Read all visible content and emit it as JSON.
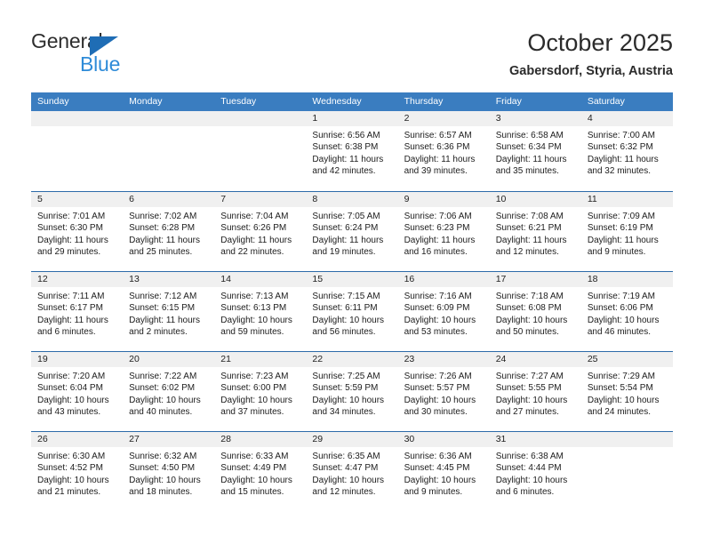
{
  "brand": {
    "name_top": "General",
    "name_bottom": "Blue",
    "triangle_color": "#1f6db5",
    "top_color": "#2e2e2e",
    "bottom_color": "#2e8bd8"
  },
  "header": {
    "title": "October 2025",
    "subtitle": "Gabersdorf, Styria, Austria"
  },
  "theme": {
    "header_row_bg": "#3a7dc0",
    "week_border": "#2d6aa8",
    "daynum_band_bg": "#f0f0f0"
  },
  "weekdays": [
    "Sunday",
    "Monday",
    "Tuesday",
    "Wednesday",
    "Thursday",
    "Friday",
    "Saturday"
  ],
  "weeks": [
    [
      {
        "day": "",
        "sunrise": "",
        "sunset": "",
        "daylight1": "",
        "daylight2": ""
      },
      {
        "day": "",
        "sunrise": "",
        "sunset": "",
        "daylight1": "",
        "daylight2": ""
      },
      {
        "day": "",
        "sunrise": "",
        "sunset": "",
        "daylight1": "",
        "daylight2": ""
      },
      {
        "day": "1",
        "sunrise": "Sunrise: 6:56 AM",
        "sunset": "Sunset: 6:38 PM",
        "daylight1": "Daylight: 11 hours",
        "daylight2": "and 42 minutes."
      },
      {
        "day": "2",
        "sunrise": "Sunrise: 6:57 AM",
        "sunset": "Sunset: 6:36 PM",
        "daylight1": "Daylight: 11 hours",
        "daylight2": "and 39 minutes."
      },
      {
        "day": "3",
        "sunrise": "Sunrise: 6:58 AM",
        "sunset": "Sunset: 6:34 PM",
        "daylight1": "Daylight: 11 hours",
        "daylight2": "and 35 minutes."
      },
      {
        "day": "4",
        "sunrise": "Sunrise: 7:00 AM",
        "sunset": "Sunset: 6:32 PM",
        "daylight1": "Daylight: 11 hours",
        "daylight2": "and 32 minutes."
      }
    ],
    [
      {
        "day": "5",
        "sunrise": "Sunrise: 7:01 AM",
        "sunset": "Sunset: 6:30 PM",
        "daylight1": "Daylight: 11 hours",
        "daylight2": "and 29 minutes."
      },
      {
        "day": "6",
        "sunrise": "Sunrise: 7:02 AM",
        "sunset": "Sunset: 6:28 PM",
        "daylight1": "Daylight: 11 hours",
        "daylight2": "and 25 minutes."
      },
      {
        "day": "7",
        "sunrise": "Sunrise: 7:04 AM",
        "sunset": "Sunset: 6:26 PM",
        "daylight1": "Daylight: 11 hours",
        "daylight2": "and 22 minutes."
      },
      {
        "day": "8",
        "sunrise": "Sunrise: 7:05 AM",
        "sunset": "Sunset: 6:24 PM",
        "daylight1": "Daylight: 11 hours",
        "daylight2": "and 19 minutes."
      },
      {
        "day": "9",
        "sunrise": "Sunrise: 7:06 AM",
        "sunset": "Sunset: 6:23 PM",
        "daylight1": "Daylight: 11 hours",
        "daylight2": "and 16 minutes."
      },
      {
        "day": "10",
        "sunrise": "Sunrise: 7:08 AM",
        "sunset": "Sunset: 6:21 PM",
        "daylight1": "Daylight: 11 hours",
        "daylight2": "and 12 minutes."
      },
      {
        "day": "11",
        "sunrise": "Sunrise: 7:09 AM",
        "sunset": "Sunset: 6:19 PM",
        "daylight1": "Daylight: 11 hours",
        "daylight2": "and 9 minutes."
      }
    ],
    [
      {
        "day": "12",
        "sunrise": "Sunrise: 7:11 AM",
        "sunset": "Sunset: 6:17 PM",
        "daylight1": "Daylight: 11 hours",
        "daylight2": "and 6 minutes."
      },
      {
        "day": "13",
        "sunrise": "Sunrise: 7:12 AM",
        "sunset": "Sunset: 6:15 PM",
        "daylight1": "Daylight: 11 hours",
        "daylight2": "and 2 minutes."
      },
      {
        "day": "14",
        "sunrise": "Sunrise: 7:13 AM",
        "sunset": "Sunset: 6:13 PM",
        "daylight1": "Daylight: 10 hours",
        "daylight2": "and 59 minutes."
      },
      {
        "day": "15",
        "sunrise": "Sunrise: 7:15 AM",
        "sunset": "Sunset: 6:11 PM",
        "daylight1": "Daylight: 10 hours",
        "daylight2": "and 56 minutes."
      },
      {
        "day": "16",
        "sunrise": "Sunrise: 7:16 AM",
        "sunset": "Sunset: 6:09 PM",
        "daylight1": "Daylight: 10 hours",
        "daylight2": "and 53 minutes."
      },
      {
        "day": "17",
        "sunrise": "Sunrise: 7:18 AM",
        "sunset": "Sunset: 6:08 PM",
        "daylight1": "Daylight: 10 hours",
        "daylight2": "and 50 minutes."
      },
      {
        "day": "18",
        "sunrise": "Sunrise: 7:19 AM",
        "sunset": "Sunset: 6:06 PM",
        "daylight1": "Daylight: 10 hours",
        "daylight2": "and 46 minutes."
      }
    ],
    [
      {
        "day": "19",
        "sunrise": "Sunrise: 7:20 AM",
        "sunset": "Sunset: 6:04 PM",
        "daylight1": "Daylight: 10 hours",
        "daylight2": "and 43 minutes."
      },
      {
        "day": "20",
        "sunrise": "Sunrise: 7:22 AM",
        "sunset": "Sunset: 6:02 PM",
        "daylight1": "Daylight: 10 hours",
        "daylight2": "and 40 minutes."
      },
      {
        "day": "21",
        "sunrise": "Sunrise: 7:23 AM",
        "sunset": "Sunset: 6:00 PM",
        "daylight1": "Daylight: 10 hours",
        "daylight2": "and 37 minutes."
      },
      {
        "day": "22",
        "sunrise": "Sunrise: 7:25 AM",
        "sunset": "Sunset: 5:59 PM",
        "daylight1": "Daylight: 10 hours",
        "daylight2": "and 34 minutes."
      },
      {
        "day": "23",
        "sunrise": "Sunrise: 7:26 AM",
        "sunset": "Sunset: 5:57 PM",
        "daylight1": "Daylight: 10 hours",
        "daylight2": "and 30 minutes."
      },
      {
        "day": "24",
        "sunrise": "Sunrise: 7:27 AM",
        "sunset": "Sunset: 5:55 PM",
        "daylight1": "Daylight: 10 hours",
        "daylight2": "and 27 minutes."
      },
      {
        "day": "25",
        "sunrise": "Sunrise: 7:29 AM",
        "sunset": "Sunset: 5:54 PM",
        "daylight1": "Daylight: 10 hours",
        "daylight2": "and 24 minutes."
      }
    ],
    [
      {
        "day": "26",
        "sunrise": "Sunrise: 6:30 AM",
        "sunset": "Sunset: 4:52 PM",
        "daylight1": "Daylight: 10 hours",
        "daylight2": "and 21 minutes."
      },
      {
        "day": "27",
        "sunrise": "Sunrise: 6:32 AM",
        "sunset": "Sunset: 4:50 PM",
        "daylight1": "Daylight: 10 hours",
        "daylight2": "and 18 minutes."
      },
      {
        "day": "28",
        "sunrise": "Sunrise: 6:33 AM",
        "sunset": "Sunset: 4:49 PM",
        "daylight1": "Daylight: 10 hours",
        "daylight2": "and 15 minutes."
      },
      {
        "day": "29",
        "sunrise": "Sunrise: 6:35 AM",
        "sunset": "Sunset: 4:47 PM",
        "daylight1": "Daylight: 10 hours",
        "daylight2": "and 12 minutes."
      },
      {
        "day": "30",
        "sunrise": "Sunrise: 6:36 AM",
        "sunset": "Sunset: 4:45 PM",
        "daylight1": "Daylight: 10 hours",
        "daylight2": "and 9 minutes."
      },
      {
        "day": "31",
        "sunrise": "Sunrise: 6:38 AM",
        "sunset": "Sunset: 4:44 PM",
        "daylight1": "Daylight: 10 hours",
        "daylight2": "and 6 minutes."
      },
      {
        "day": "",
        "sunrise": "",
        "sunset": "",
        "daylight1": "",
        "daylight2": ""
      }
    ]
  ]
}
